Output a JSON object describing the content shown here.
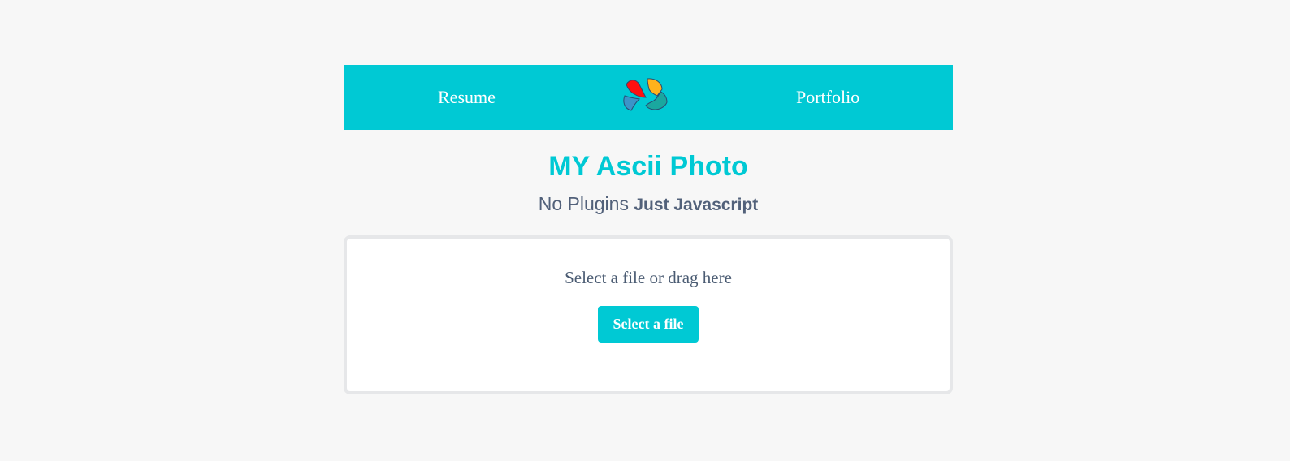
{
  "nav": {
    "left_link": "Resume",
    "right_link": "Portfolio",
    "logo_icon": "colorful-flower-logo-icon"
  },
  "header": {
    "title": "MY Ascii Photo",
    "subtitle_plain": "No Plugins",
    "subtitle_strong": "Just Javascript"
  },
  "upload": {
    "prompt": "Select a file or drag here",
    "button_label": "Select a file"
  },
  "colors": {
    "accent": "#00c9d4",
    "text": "#52617a",
    "background": "#f7f7f7"
  }
}
